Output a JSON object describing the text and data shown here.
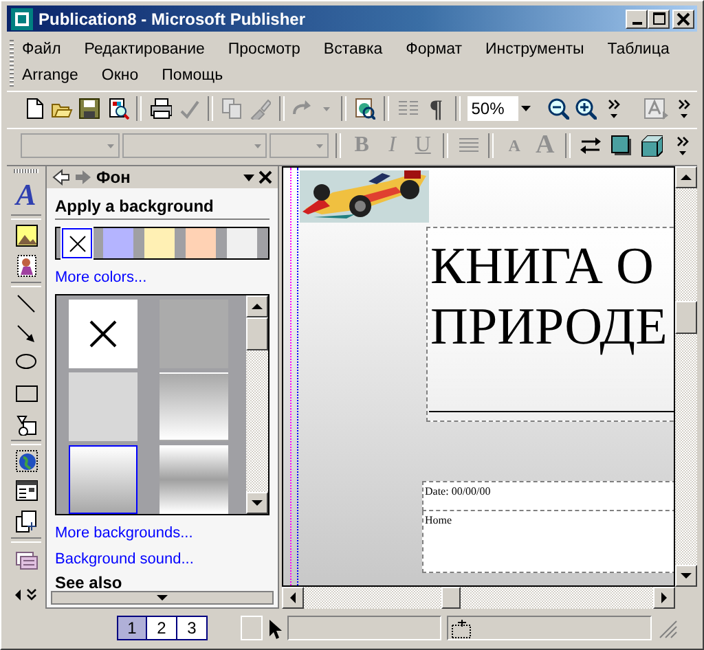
{
  "window": {
    "title": "Publication8 - Microsoft Publisher"
  },
  "menu_rows": [
    {
      "items": [
        "Файл",
        "Редактирование",
        "Просмотр",
        "Вставка",
        "Формат",
        "Инструменты",
        "Таблица"
      ]
    },
    {
      "items": [
        "Arrange",
        "Окно",
        "Помощь"
      ]
    }
  ],
  "toolbar": {
    "pilcrow": "¶",
    "zoom": "50%"
  },
  "format_toolbar": {
    "style_buttons": [
      {
        "kind": "bold",
        "label": "B"
      },
      {
        "kind": "italic",
        "label": "I"
      },
      {
        "kind": "underline",
        "label": "U"
      }
    ],
    "size_buttons": [
      {
        "kind": "shrink",
        "label": "A"
      },
      {
        "kind": "grow",
        "label": "A"
      }
    ]
  },
  "objects_toolbar": {
    "text_tool": "A"
  },
  "task_pane": {
    "title": "Фон",
    "heading": "Apply a background",
    "swatches": [
      {
        "kind": "none",
        "selected": true
      },
      {
        "kind": "color",
        "color": "#b4b4ff",
        "selected": false
      },
      {
        "kind": "color",
        "color": "#fff0b4",
        "selected": false
      },
      {
        "kind": "color",
        "color": "#ffd2b4",
        "selected": false
      },
      {
        "kind": "color",
        "color": "#f0f0f0",
        "selected": false
      }
    ],
    "more_colors": "More colors...",
    "backgrounds": [
      {
        "kind": "none",
        "selected": false
      },
      {
        "kind": "dark",
        "selected": false
      },
      {
        "kind": "light",
        "selected": false
      },
      {
        "kind": "fade-down",
        "selected": false
      },
      {
        "kind": "fade-up",
        "selected": true
      },
      {
        "kind": "band",
        "selected": false
      }
    ],
    "links": [
      "More backgrounds...",
      "Background sound..."
    ],
    "see_also": "See also"
  },
  "publication": {
    "title": "КНИГА О ПРИРОДЕ",
    "date": "Date: 00/00/00",
    "address": "Home"
  },
  "pages": [
    {
      "label": "1",
      "selected": true
    },
    {
      "label": "2",
      "selected": false
    },
    {
      "label": "3",
      "selected": false
    }
  ]
}
